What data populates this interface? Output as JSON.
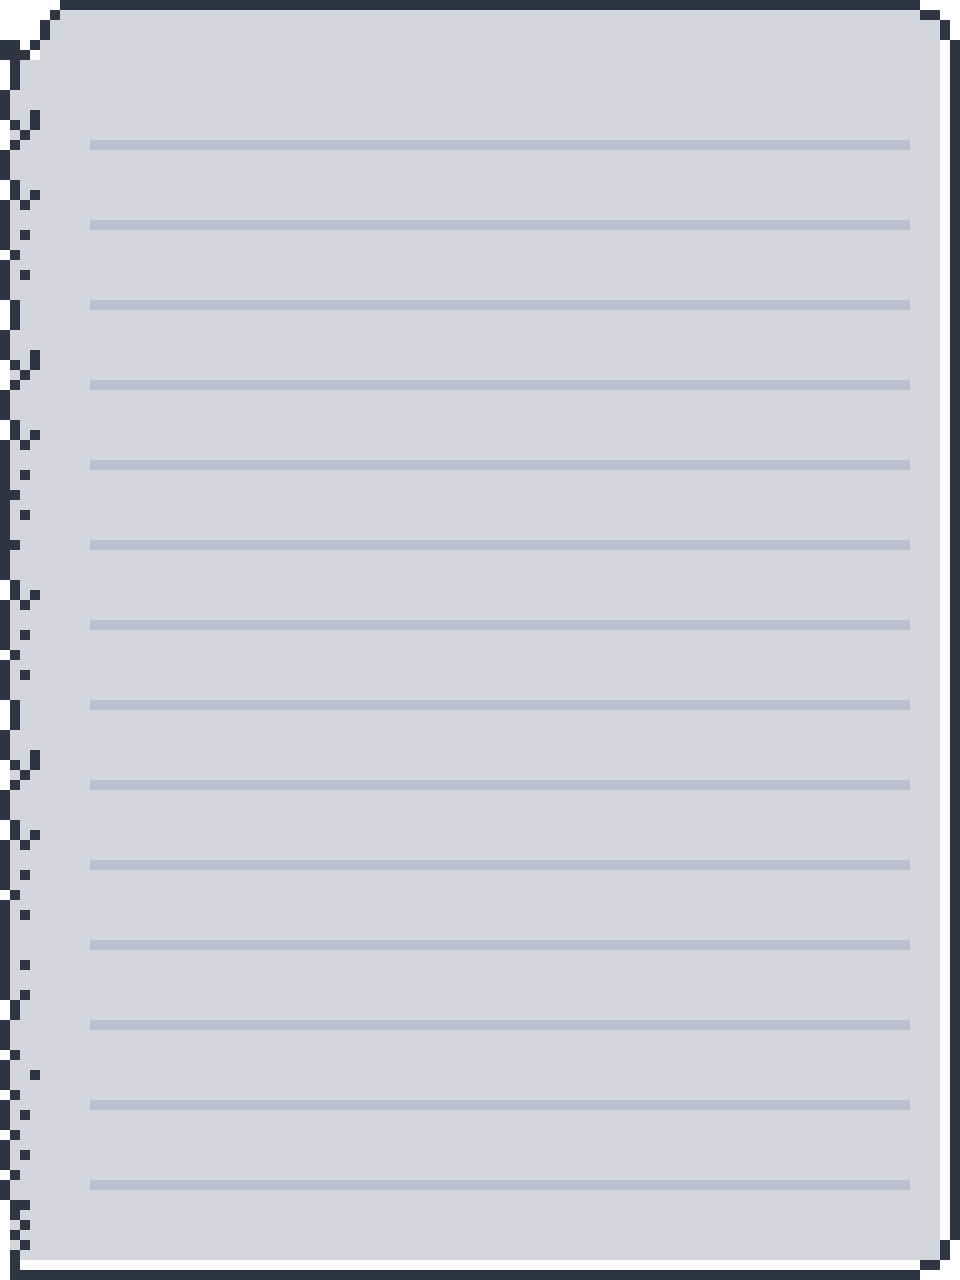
{
  "page": {
    "kind": "lined-notepad-sheet"
  },
  "paper": {
    "fill_color": "#d5d6dc",
    "outline_color": "#2e3643",
    "rule_color": "#bac0ce",
    "background_color": "#ffffff",
    "style": "pixel-art",
    "left_edge": "torn",
    "corners": "rounded",
    "ruled_line_count": 14
  },
  "icons": {
    "sheet": "lined-paper-icon"
  }
}
